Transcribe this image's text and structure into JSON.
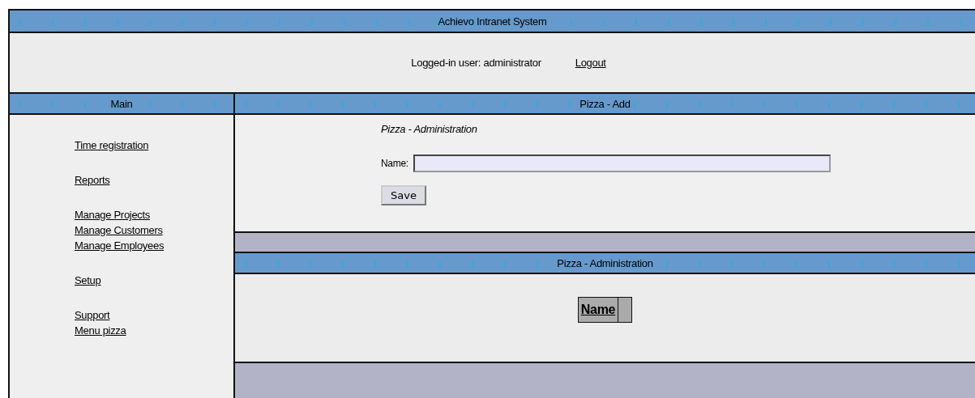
{
  "window": {
    "title": "Achievo Intranet System"
  },
  "user_bar": {
    "label": "Logged-in user: administrator",
    "logout": "Logout"
  },
  "sidebar": {
    "title": "Main",
    "groups": [
      {
        "items": [
          "Time registration"
        ]
      },
      {
        "items": [
          "Reports"
        ]
      },
      {
        "items": [
          "Manage Projects",
          "Manage Customers",
          "Manage Employees"
        ]
      },
      {
        "items": [
          "Setup"
        ]
      },
      {
        "items": [
          "Support",
          "Menu pizza"
        ]
      }
    ]
  },
  "form_panel": {
    "title": "Pizza - Add",
    "subtitle": "Pizza - Administration",
    "field": {
      "label": "Name:"
    },
    "save_button": "Save"
  },
  "list_panel": {
    "title": "Pizza - Administration",
    "table": {
      "columns": [
        "Name"
      ]
    }
  }
}
